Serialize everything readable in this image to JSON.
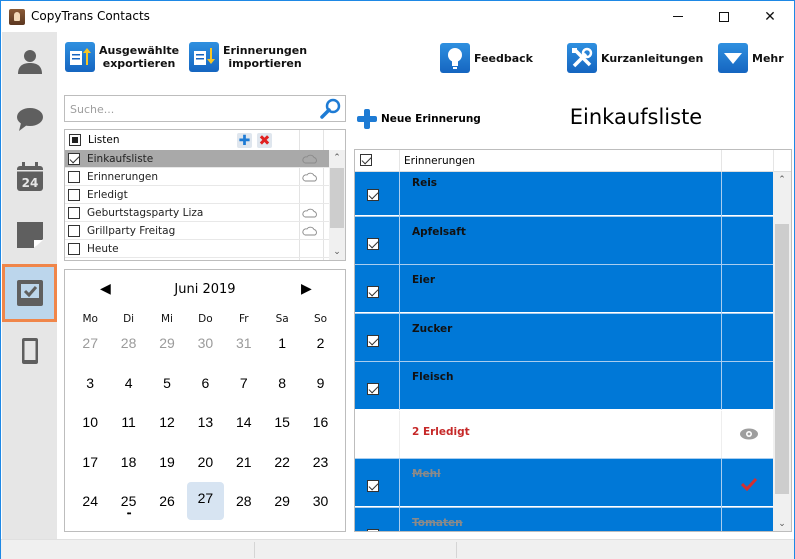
{
  "window": {
    "title": "CopyTrans Contacts"
  },
  "sidebar": {
    "items": [
      {
        "name": "contacts",
        "icon": "person-icon",
        "active": false
      },
      {
        "name": "messages",
        "icon": "speech-bubble-icon",
        "active": false
      },
      {
        "name": "calendars",
        "icon": "calendar-icon",
        "active": false,
        "badge": "24"
      },
      {
        "name": "notes",
        "icon": "note-icon",
        "active": false
      },
      {
        "name": "reminders",
        "icon": "reminders-check-icon",
        "active": true
      },
      {
        "name": "device",
        "icon": "phone-icon",
        "active": false
      }
    ]
  },
  "toolbar": {
    "export_label_line1": "Ausgewählte",
    "export_label_line2": "exportieren",
    "import_label_line1": "Erinnerungen",
    "import_label_line2": "importieren",
    "feedback_label": "Feedback",
    "guides_label": "Kurzanleitungen",
    "more_label": "Mehr"
  },
  "search": {
    "placeholder": "Suche..."
  },
  "lists": {
    "header_label": "Listen",
    "items": [
      {
        "name": "Einkaufsliste",
        "checked": true,
        "selected": true,
        "cloud": true
      },
      {
        "name": "Erinnerungen",
        "checked": false,
        "selected": false,
        "cloud": true
      },
      {
        "name": "Erledigt",
        "checked": false,
        "selected": false,
        "cloud": false
      },
      {
        "name": "Geburtstagsparty Liza",
        "checked": false,
        "selected": false,
        "cloud": true
      },
      {
        "name": "Grillparty Freitag",
        "checked": false,
        "selected": false,
        "cloud": true
      },
      {
        "name": "Heute",
        "checked": false,
        "selected": false,
        "cloud": false
      }
    ]
  },
  "calendar": {
    "month_label": "Juni 2019",
    "weekdays": [
      "Mo",
      "Di",
      "Mi",
      "Do",
      "Fr",
      "Sa",
      "So"
    ],
    "weeks": [
      [
        {
          "d": "27",
          "other": true
        },
        {
          "d": "28",
          "other": true
        },
        {
          "d": "29",
          "other": true
        },
        {
          "d": "30",
          "other": true
        },
        {
          "d": "31",
          "other": true
        },
        {
          "d": "1"
        },
        {
          "d": "2"
        }
      ],
      [
        {
          "d": "3"
        },
        {
          "d": "4"
        },
        {
          "d": "5"
        },
        {
          "d": "6"
        },
        {
          "d": "7"
        },
        {
          "d": "8"
        },
        {
          "d": "9"
        }
      ],
      [
        {
          "d": "10"
        },
        {
          "d": "11"
        },
        {
          "d": "12"
        },
        {
          "d": "13"
        },
        {
          "d": "14"
        },
        {
          "d": "15"
        },
        {
          "d": "16"
        }
      ],
      [
        {
          "d": "17"
        },
        {
          "d": "18"
        },
        {
          "d": "19"
        },
        {
          "d": "20"
        },
        {
          "d": "21"
        },
        {
          "d": "22"
        },
        {
          "d": "23"
        }
      ],
      [
        {
          "d": "24"
        },
        {
          "d": "25",
          "dots": "••"
        },
        {
          "d": "26"
        },
        {
          "d": "27",
          "today": true
        },
        {
          "d": "28"
        },
        {
          "d": "29"
        },
        {
          "d": "30"
        }
      ]
    ]
  },
  "reminders": {
    "new_label": "Neue Erinnerung",
    "list_title": "Einkaufsliste",
    "column_header": "Erinnerungen",
    "rows": [
      {
        "text": "Reis",
        "checked": true,
        "type": "item"
      },
      {
        "text": "Apfelsaft",
        "checked": true,
        "type": "item"
      },
      {
        "text": "Eier",
        "checked": true,
        "type": "item"
      },
      {
        "text": "Zucker",
        "checked": true,
        "type": "item"
      },
      {
        "text": "Fleisch",
        "checked": true,
        "type": "item"
      },
      {
        "text": "2 Erledigt",
        "type": "completed-header",
        "icon": "eye-icon"
      },
      {
        "text": "Mehl",
        "checked": true,
        "type": "done",
        "icon": "red-check-icon"
      },
      {
        "text": "Tomaten",
        "checked": true,
        "type": "done"
      }
    ]
  },
  "colors": {
    "accent": "#0078d7",
    "sidebar_active_border": "#f0864a",
    "completed_red": "#c62828"
  }
}
